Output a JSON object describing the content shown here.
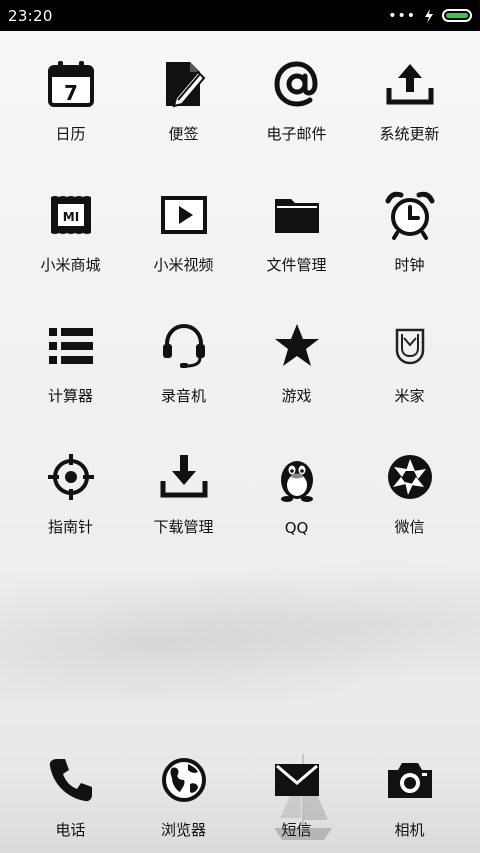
{
  "status_bar": {
    "time": "23:20",
    "signal_icon": "dots-icon",
    "charging_icon": "bolt-icon",
    "battery_level": 1.0,
    "battery_color": "#2ecc40"
  },
  "apps": [
    {
      "label": "日历",
      "icon": "calendar-icon",
      "calendar_day": "7"
    },
    {
      "label": "便签",
      "icon": "notes-icon"
    },
    {
      "label": "电子邮件",
      "icon": "email-at-icon"
    },
    {
      "label": "系统更新",
      "icon": "upload-icon"
    },
    {
      "label": "小米商城",
      "icon": "mi-store-icon",
      "badge": "MI"
    },
    {
      "label": "小米视频",
      "icon": "video-play-icon"
    },
    {
      "label": "文件管理",
      "icon": "folder-icon"
    },
    {
      "label": "时钟",
      "icon": "alarm-clock-icon"
    },
    {
      "label": "计算器",
      "icon": "list-icon"
    },
    {
      "label": "录音机",
      "icon": "headset-icon"
    },
    {
      "label": "游戏",
      "icon": "star-icon"
    },
    {
      "label": "米家",
      "icon": "mijia-icon"
    },
    {
      "label": "指南针",
      "icon": "target-icon"
    },
    {
      "label": "下载管理",
      "icon": "download-icon"
    },
    {
      "label": "QQ",
      "icon": "penguin-icon"
    },
    {
      "label": "微信",
      "icon": "aperture-icon"
    }
  ],
  "dock": [
    {
      "label": "电话",
      "icon": "phone-icon"
    },
    {
      "label": "浏览器",
      "icon": "globe-icon"
    },
    {
      "label": "短信",
      "icon": "envelope-icon"
    },
    {
      "label": "相机",
      "icon": "camera-icon"
    }
  ]
}
